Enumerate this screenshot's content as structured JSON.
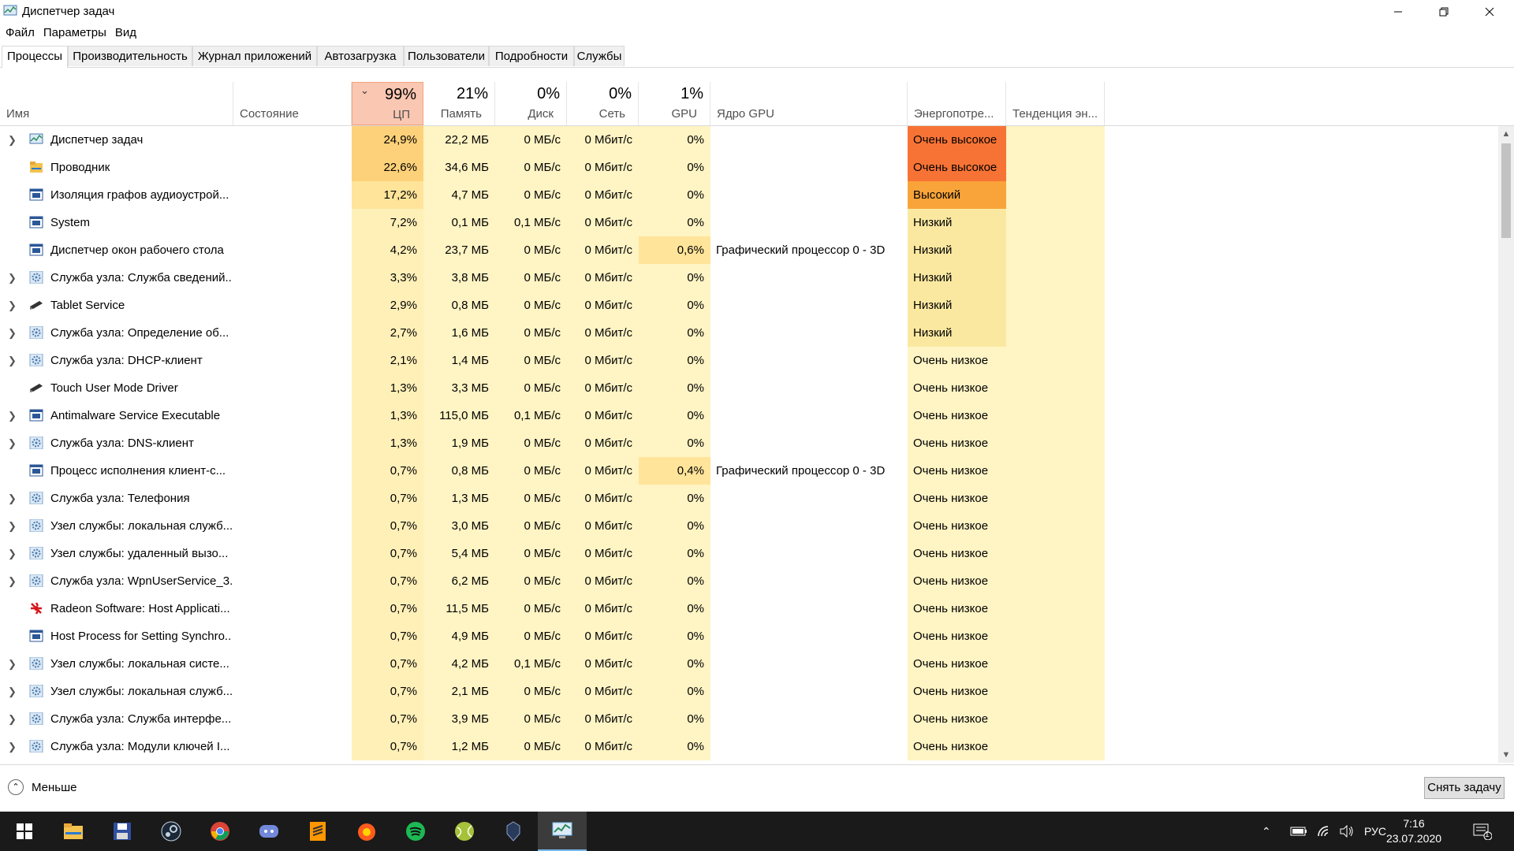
{
  "window": {
    "title": "Диспетчер задач"
  },
  "menu": [
    "Файл",
    "Параметры",
    "Вид"
  ],
  "tabs": [
    "Процессы",
    "Производительность",
    "Журнал приложений",
    "Автозагрузка",
    "Пользователи",
    "Подробности",
    "Службы"
  ],
  "header": {
    "name": "Имя",
    "status": "Состояние",
    "cpu_pct": "99%",
    "cpu": "ЦП",
    "mem_pct": "21%",
    "mem": "Память",
    "disk_pct": "0%",
    "disk": "Диск",
    "net_pct": "0%",
    "net": "Сеть",
    "gpu_pct": "1%",
    "gpu": "GPU",
    "gpu_engine": "Ядро GPU",
    "power": "Энергопотре...",
    "power_trend": "Тенденция эн..."
  },
  "processes": [
    {
      "name": "Диспетчер задач",
      "expandable": true,
      "icon": "taskmgr",
      "cpu": "24,9%",
      "mem": "22,2 МБ",
      "disk": "0 МБ/с",
      "net": "0 Мбит/с",
      "gpu": "0%",
      "engine": "",
      "power": "Очень высокое",
      "power_level": "very-high",
      "cpu_level": 3
    },
    {
      "name": "Проводник",
      "expandable": false,
      "icon": "folder",
      "cpu": "22,6%",
      "mem": "34,6 МБ",
      "disk": "0 МБ/с",
      "net": "0 Мбит/с",
      "gpu": "0%",
      "engine": "",
      "power": "Очень высокое",
      "power_level": "very-high",
      "cpu_level": 3
    },
    {
      "name": "Изоляция графов аудиоустрой...",
      "expandable": false,
      "icon": "window",
      "cpu": "17,2%",
      "mem": "4,7 МБ",
      "disk": "0 МБ/с",
      "net": "0 Мбит/с",
      "gpu": "0%",
      "engine": "",
      "power": "Высокий",
      "power_level": "high",
      "cpu_level": 2
    },
    {
      "name": "System",
      "expandable": false,
      "icon": "window",
      "cpu": "7,2%",
      "mem": "0,1 МБ",
      "disk": "0,1 МБ/с",
      "net": "0 Мбит/с",
      "gpu": "0%",
      "engine": "",
      "power": "Низкий",
      "power_level": "low",
      "cpu_level": 1
    },
    {
      "name": "Диспетчер окон рабочего стола",
      "expandable": false,
      "icon": "window",
      "cpu": "4,2%",
      "mem": "23,7 МБ",
      "disk": "0 МБ/с",
      "net": "0 Мбит/с",
      "gpu": "0,6%",
      "gpu_hi": true,
      "engine": "Графический процессор 0 - 3D",
      "power": "Низкий",
      "power_level": "low",
      "cpu_level": 1
    },
    {
      "name": "Служба узла: Служба сведений...",
      "expandable": true,
      "icon": "gear",
      "cpu": "3,3%",
      "mem": "3,8 МБ",
      "disk": "0 МБ/с",
      "net": "0 Мбит/с",
      "gpu": "0%",
      "engine": "",
      "power": "Низкий",
      "power_level": "low",
      "cpu_level": 1
    },
    {
      "name": "Tablet Service",
      "expandable": true,
      "icon": "pen",
      "cpu": "2,9%",
      "mem": "0,8 МБ",
      "disk": "0 МБ/с",
      "net": "0 Мбит/с",
      "gpu": "0%",
      "engine": "",
      "power": "Низкий",
      "power_level": "low",
      "cpu_level": 1
    },
    {
      "name": "Служба узла: Определение об...",
      "expandable": true,
      "icon": "gear",
      "cpu": "2,7%",
      "mem": "1,6 МБ",
      "disk": "0 МБ/с",
      "net": "0 Мбит/с",
      "gpu": "0%",
      "engine": "",
      "power": "Низкий",
      "power_level": "low",
      "cpu_level": 1
    },
    {
      "name": "Служба узла: DHCP-клиент",
      "expandable": true,
      "icon": "gear",
      "cpu": "2,1%",
      "mem": "1,4 МБ",
      "disk": "0 МБ/с",
      "net": "0 Мбит/с",
      "gpu": "0%",
      "engine": "",
      "power": "Очень низкое",
      "power_level": "very-low",
      "cpu_level": 1
    },
    {
      "name": "Touch User Mode Driver",
      "expandable": false,
      "icon": "pen",
      "cpu": "1,3%",
      "mem": "3,3 МБ",
      "disk": "0 МБ/с",
      "net": "0 Мбит/с",
      "gpu": "0%",
      "engine": "",
      "power": "Очень низкое",
      "power_level": "very-low",
      "cpu_level": 1
    },
    {
      "name": "Antimalware Service Executable",
      "expandable": true,
      "icon": "window",
      "cpu": "1,3%",
      "mem": "115,0 МБ",
      "disk": "0,1 МБ/с",
      "net": "0 Мбит/с",
      "gpu": "0%",
      "engine": "",
      "power": "Очень низкое",
      "power_level": "very-low",
      "cpu_level": 1
    },
    {
      "name": "Служба узла: DNS-клиент",
      "expandable": true,
      "icon": "gear",
      "cpu": "1,3%",
      "mem": "1,9 МБ",
      "disk": "0 МБ/с",
      "net": "0 Мбит/с",
      "gpu": "0%",
      "engine": "",
      "power": "Очень низкое",
      "power_level": "very-low",
      "cpu_level": 1
    },
    {
      "name": "Процесс исполнения клиент-с...",
      "expandable": false,
      "icon": "window",
      "cpu": "0,7%",
      "mem": "0,8 МБ",
      "disk": "0 МБ/с",
      "net": "0 Мбит/с",
      "gpu": "0,4%",
      "gpu_hi": true,
      "engine": "Графический процессор 0 - 3D",
      "power": "Очень низкое",
      "power_level": "very-low",
      "cpu_level": 1
    },
    {
      "name": "Служба узла: Телефония",
      "expandable": true,
      "icon": "gear",
      "cpu": "0,7%",
      "mem": "1,3 МБ",
      "disk": "0 МБ/с",
      "net": "0 Мбит/с",
      "gpu": "0%",
      "engine": "",
      "power": "Очень низкое",
      "power_level": "very-low",
      "cpu_level": 1
    },
    {
      "name": "Узел службы: локальная служб...",
      "expandable": true,
      "icon": "gear",
      "cpu": "0,7%",
      "mem": "3,0 МБ",
      "disk": "0 МБ/с",
      "net": "0 Мбит/с",
      "gpu": "0%",
      "engine": "",
      "power": "Очень низкое",
      "power_level": "very-low",
      "cpu_level": 1
    },
    {
      "name": "Узел службы: удаленный вызо...",
      "expandable": true,
      "icon": "gear",
      "cpu": "0,7%",
      "mem": "5,4 МБ",
      "disk": "0 МБ/с",
      "net": "0 Мбит/с",
      "gpu": "0%",
      "engine": "",
      "power": "Очень низкое",
      "power_level": "very-low",
      "cpu_level": 1
    },
    {
      "name": "Служба узла: WpnUserService_3...",
      "expandable": true,
      "icon": "gear",
      "cpu": "0,7%",
      "mem": "6,2 МБ",
      "disk": "0 МБ/с",
      "net": "0 Мбит/с",
      "gpu": "0%",
      "engine": "",
      "power": "Очень низкое",
      "power_level": "very-low",
      "cpu_level": 1
    },
    {
      "name": "Radeon Software: Host Applicati...",
      "expandable": false,
      "icon": "radeon",
      "cpu": "0,7%",
      "mem": "11,5 МБ",
      "disk": "0 МБ/с",
      "net": "0 Мбит/с",
      "gpu": "0%",
      "engine": "",
      "power": "Очень низкое",
      "power_level": "very-low",
      "cpu_level": 1
    },
    {
      "name": "Host Process for Setting Synchro...",
      "expandable": false,
      "icon": "window",
      "cpu": "0,7%",
      "mem": "4,9 МБ",
      "disk": "0 МБ/с",
      "net": "0 Мбит/с",
      "gpu": "0%",
      "engine": "",
      "power": "Очень низкое",
      "power_level": "very-low",
      "cpu_level": 1
    },
    {
      "name": "Узел службы: локальная систе...",
      "expandable": true,
      "icon": "gear",
      "cpu": "0,7%",
      "mem": "4,2 МБ",
      "disk": "0,1 МБ/с",
      "net": "0 Мбит/с",
      "gpu": "0%",
      "engine": "",
      "power": "Очень низкое",
      "power_level": "very-low",
      "cpu_level": 1
    },
    {
      "name": "Узел службы: локальная служб...",
      "expandable": true,
      "icon": "gear",
      "cpu": "0,7%",
      "mem": "2,1 МБ",
      "disk": "0 МБ/с",
      "net": "0 Мбит/с",
      "gpu": "0%",
      "engine": "",
      "power": "Очень низкое",
      "power_level": "very-low",
      "cpu_level": 1
    },
    {
      "name": "Служба узла: Служба интерфе...",
      "expandable": true,
      "icon": "gear",
      "cpu": "0,7%",
      "mem": "3,9 МБ",
      "disk": "0 МБ/с",
      "net": "0 Мбит/с",
      "gpu": "0%",
      "engine": "",
      "power": "Очень низкое",
      "power_level": "very-low",
      "cpu_level": 1
    },
    {
      "name": "Служба узла: Модули ключей I...",
      "expandable": true,
      "icon": "gear",
      "cpu": "0,7%",
      "mem": "1,2 МБ",
      "disk": "0 МБ/с",
      "net": "0 Мбит/с",
      "gpu": "0%",
      "engine": "",
      "power": "Очень низкое",
      "power_level": "very-low",
      "cpu_level": 1
    }
  ],
  "footer": {
    "fewer": "Меньше",
    "end_task": "Снять задачу"
  },
  "taskbar": {
    "apps": [
      "windows-start",
      "file-explorer",
      "save-app",
      "steam",
      "chrome",
      "discord",
      "sublime-text",
      "music-app",
      "spotify",
      "tennis-app",
      "game-app",
      "task-manager"
    ],
    "lang": "РУС",
    "time": "7:16",
    "date": "23.07.2020",
    "notif_count": "1"
  },
  "colors": {
    "cpu_header": "#f9c7b2",
    "very_high": "#f77335",
    "high": "#f9a43a",
    "low": "#fbe8a0",
    "cell_light": "#fff4c4",
    "cpu_lvl1": "#fff0b8",
    "cpu_lvl2": "#ffe49a",
    "cpu_lvl3": "#fdd17a"
  }
}
